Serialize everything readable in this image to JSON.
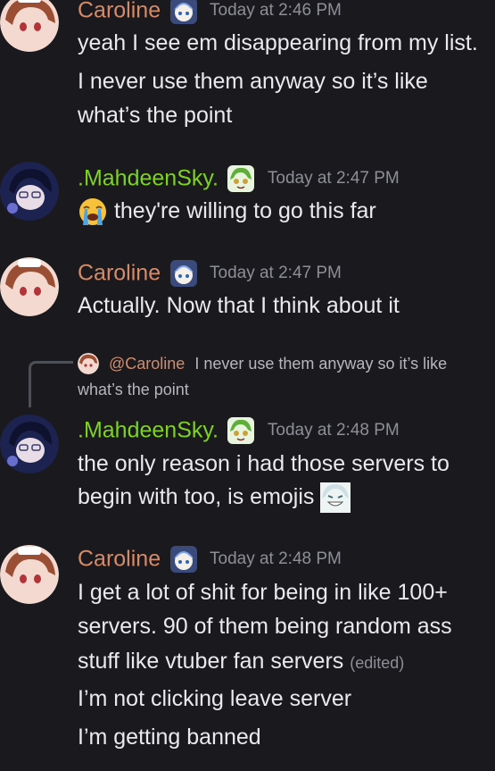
{
  "colors": {
    "background": "#1a1a1e",
    "caroline_name": "#d48b6a",
    "mahdeen_name": "#7ed321",
    "timestamp": "#8d8f97",
    "text": "#e9e9ee"
  },
  "messages": [
    {
      "author": "Caroline",
      "timestamp": "Today at 2:46 PM",
      "badge_icon": "blue-haired-chibi-badge",
      "lines": [
        "yeah I see em disappearing from my list.",
        "I never use them anyway so it’s like",
        "what’s the point"
      ]
    },
    {
      "author": ".MahdeenSky.",
      "timestamp": "Today at 2:47 PM",
      "badge_icon": "green-haired-chibi-badge",
      "emoji_icon": "loudly-crying-face-emoji",
      "lines": [
        "they're willing to go this far"
      ]
    },
    {
      "author": "Caroline",
      "timestamp": "Today at 2:47 PM",
      "badge_icon": "blue-haired-chibi-badge",
      "lines": [
        "Actually. Now that I think about it"
      ]
    },
    {
      "author": ".MahdeenSky.",
      "timestamp": "Today at 2:48 PM",
      "badge_icon": "green-haired-chibi-badge",
      "reply": {
        "mention": "@Caroline",
        "snippet_line1": "I never use them anyway so it’s like",
        "snippet_line2": "what’s the point"
      },
      "lines": [
        "the only reason i had those servers to",
        "begin with too, is emojis"
      ],
      "trailing_emoji_icon": "grinning-anime-girl-emoji"
    },
    {
      "author": "Caroline",
      "timestamp": "Today at 2:48 PM",
      "badge_icon": "blue-haired-chibi-badge",
      "lines": [
        "I get a lot of shit for being in like 100+",
        "servers. 90 of them being random ass",
        "stuff like vtuber fan servers",
        "I’m not clicking leave server",
        "I’m getting banned"
      ],
      "edited_label": "(edited)"
    }
  ]
}
